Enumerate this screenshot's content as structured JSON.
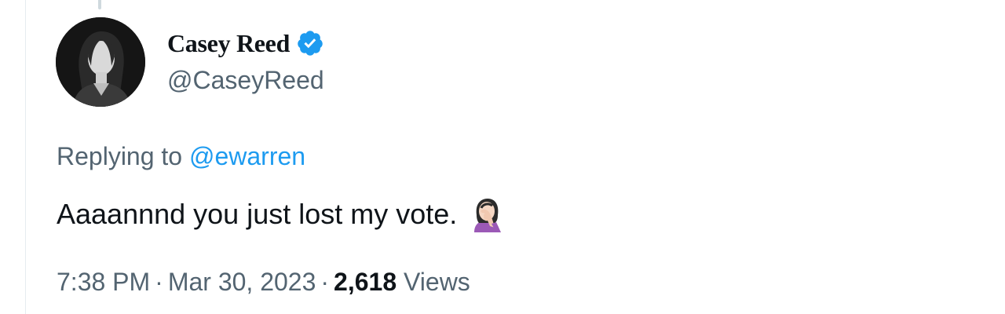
{
  "tweet": {
    "author": {
      "display_name": "Casey Reed",
      "handle": "@CaseyReed",
      "verified": true,
      "avatar_icon": "profile-photo"
    },
    "replying_to": {
      "prefix": "Replying to",
      "mention": "@ewarren"
    },
    "text": "Aaaannnd you just lost my vote.",
    "emoji": "🤦🏻‍♀️",
    "meta": {
      "time": "7:38 PM",
      "separator": "·",
      "date": "Mar 30, 2023",
      "view_count": "2,618",
      "views_label": "Views"
    }
  },
  "colors": {
    "accent": "#1d9bf0",
    "secondary_text": "#536471",
    "primary_text": "#0f1419",
    "verified_badge": "#1d9bf0"
  }
}
